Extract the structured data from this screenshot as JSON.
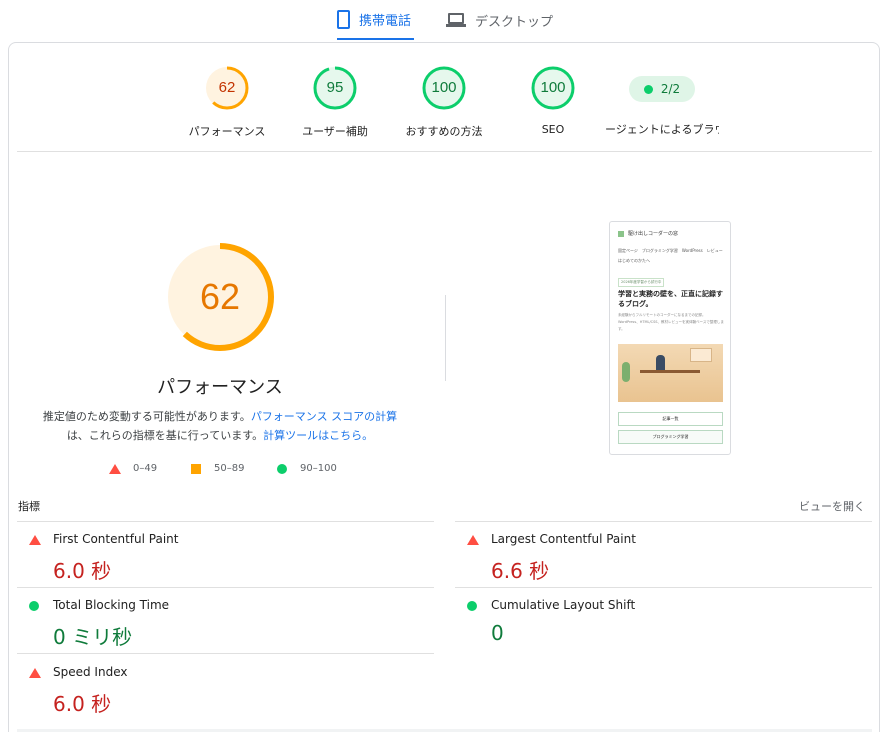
{
  "tabs": {
    "mobile_label": "携帯電話",
    "desktop_label": "デスクトップ"
  },
  "categories": [
    {
      "label": "パフォーマンス",
      "score": "62",
      "color": "#ffa400"
    },
    {
      "label": "ユーザー補助",
      "score": "95",
      "color": "#0cce6b"
    },
    {
      "label": "おすすめの方法",
      "score": "100",
      "color": "#0cce6b"
    },
    {
      "label": "SEO",
      "score": "100",
      "color": "#0cce6b"
    }
  ],
  "pwa": {
    "value": "2/2",
    "label": "ージェントによるブラウジング"
  },
  "performance": {
    "score": "62",
    "title": "パフォーマンス",
    "desc_prefix": "推定値のため変動する可能性があります。",
    "link1": "パフォーマンス スコアの計算",
    "desc_middle": "は、これらの指標を基に行っています。",
    "link2": "計算ツールはこちら。"
  },
  "legend": {
    "red": "0–49",
    "orange": "50–89",
    "green": "90–100"
  },
  "thumbnail": {
    "site_title": "駆け出しコーダーの窓",
    "nav_line1": "固定ページ　ブログラミング学習　WordPress　レビュー",
    "nav_line2": "はじめてのかたへ",
    "badge": "2026年度学習から試行中",
    "headline": "学習と実務の壁を、正直に記録するブログ。",
    "body": "未経験からフルリモートのコーダーになるまでの記録。WordPress、HTML/CSS、教材レビューを実体験ベースで整理します。",
    "button1": "記事一覧",
    "button2": "プログラミング学習"
  },
  "metrics": {
    "heading": "指標",
    "expand_label": "ビューを開く",
    "items": [
      {
        "name": "First Contentful Paint",
        "value": "6.0 秒",
        "status": "red"
      },
      {
        "name": "Largest Contentful Paint",
        "value": "6.6 秒",
        "status": "red"
      },
      {
        "name": "Total Blocking Time",
        "value": "0 ミリ秒",
        "status": "green"
      },
      {
        "name": "Cumulative Layout Shift",
        "value": "0",
        "status": "green"
      },
      {
        "name": "Speed Index",
        "value": "6.0 秒",
        "status": "red"
      }
    ]
  },
  "colors": {
    "accent": "#1a73e8",
    "average": "#ffa400",
    "pass": "#0cce6b",
    "fail": "#ff4e42"
  }
}
